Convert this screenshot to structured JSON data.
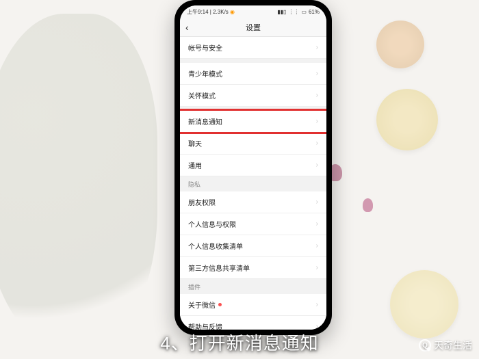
{
  "statusbar": {
    "time": "上午9:14",
    "net": "2.3K/s",
    "alarm": "⏰",
    "signal": "📶",
    "wifi": "📶",
    "battery_pct": "61%"
  },
  "navbar": {
    "back_icon": "‹",
    "title": "设置"
  },
  "sections": {
    "g1": [
      {
        "label": "帐号与安全"
      }
    ],
    "g2": [
      {
        "label": "青少年模式"
      },
      {
        "label": "关怀模式"
      }
    ],
    "g3": [
      {
        "label": "新消息通知",
        "highlighted": true
      },
      {
        "label": "聊天"
      },
      {
        "label": "通用"
      }
    ],
    "privacy_header": "隐私",
    "g4": [
      {
        "label": "朋友权限"
      },
      {
        "label": "个人信息与权限"
      },
      {
        "label": "个人信息收集清单"
      },
      {
        "label": "第三方信息共享清单"
      }
    ],
    "plugin_header": "插件",
    "g5": [
      {
        "label": "关于微信",
        "dot": true
      },
      {
        "label": "帮助与反馈"
      }
    ]
  },
  "chevron": "›",
  "caption": "4、打开新消息通知",
  "watermark": "天奇生活"
}
